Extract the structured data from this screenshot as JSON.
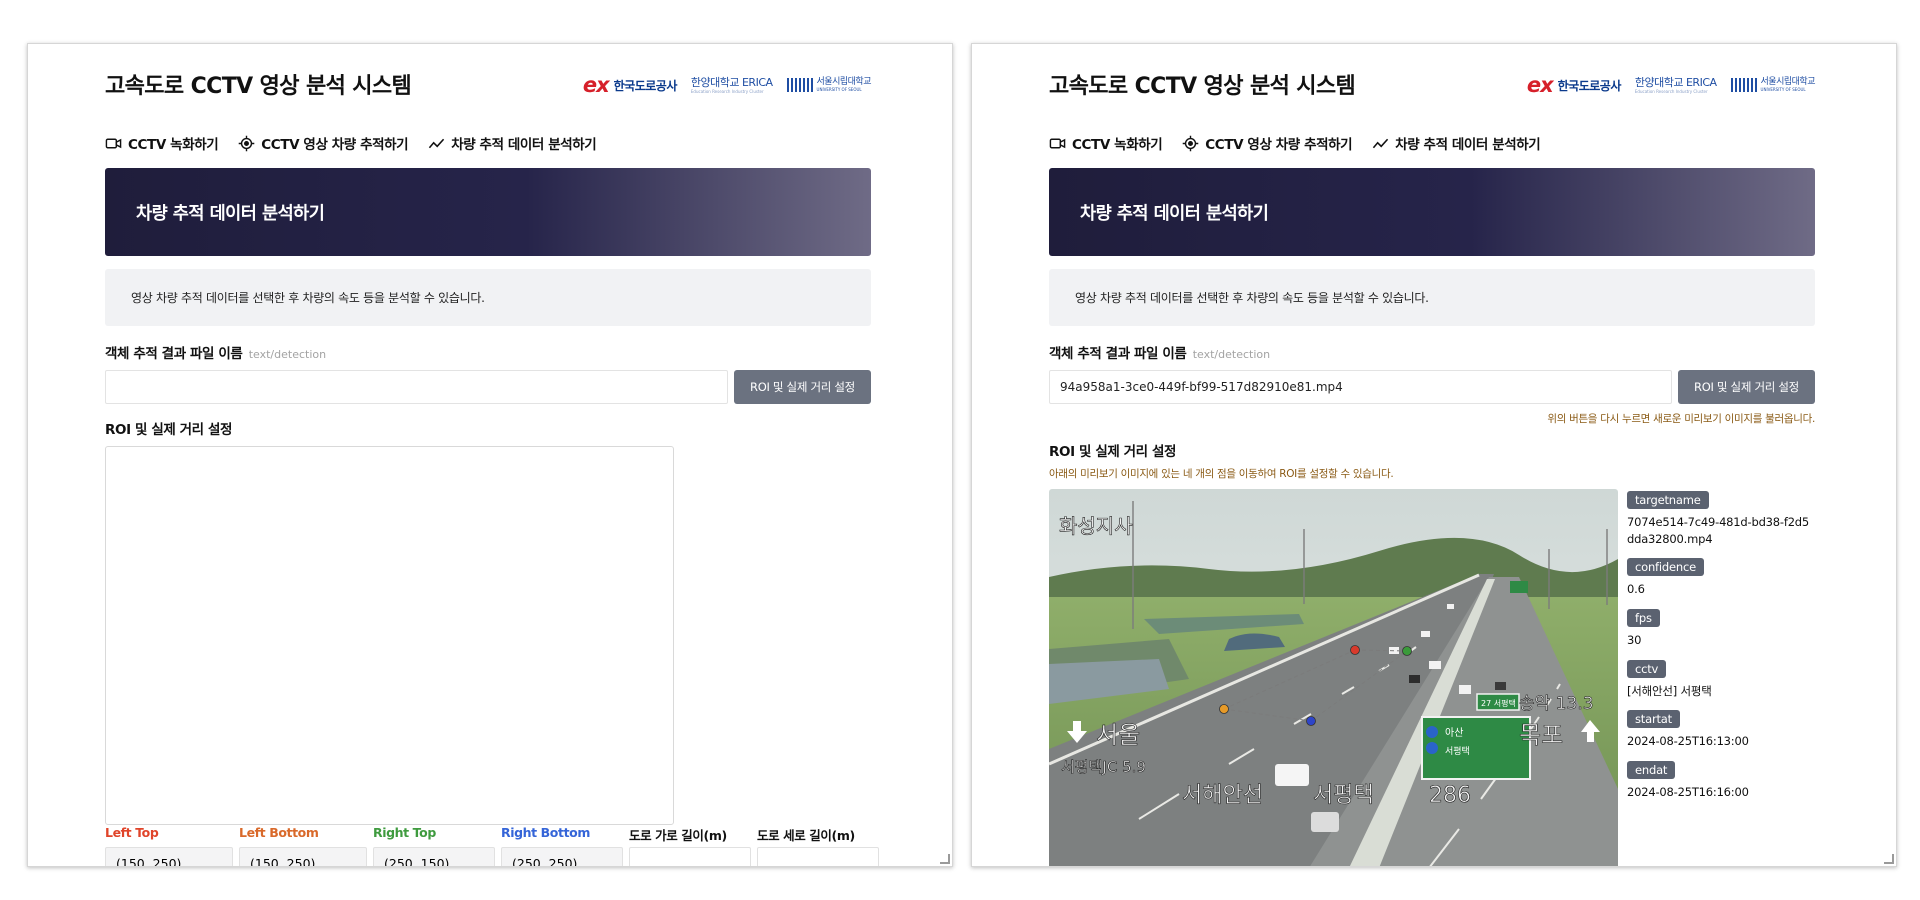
{
  "app": {
    "title": "고속도로 CCTV 영상 분석 시스템",
    "logos": {
      "ex_mark": "ex",
      "ex_text": "한국도로공사",
      "hanyang": "한양대학교 ERICA",
      "hanyang_sub": "Education Research Industry Cluster",
      "seoul": "서울시립대학교",
      "seoul_sub": "UNIVERSITY OF SEOUL"
    }
  },
  "nav": [
    {
      "label": "CCTV 녹화하기",
      "icon": "video-camera-icon"
    },
    {
      "label": "CCTV 영상 차량 추적하기",
      "icon": "target-icon"
    },
    {
      "label": "차량 추적 데이터 분석하기",
      "icon": "trend-line-icon"
    }
  ],
  "banner": {
    "title": "차량 추적 데이터 분석하기"
  },
  "info": "영상 차량 추적 데이터를 선택한 후 차량의 속도 등을 분석할 수 있습니다.",
  "file_section": {
    "label": "객체 추적 결과 파일 이름",
    "hint": "text/detection",
    "button": "ROI 및 실제 거리 설정"
  },
  "roi_section": {
    "label": "ROI 및 실제 거리 설정"
  },
  "left": {
    "file_value": "",
    "coords": {
      "left_top": {
        "label": "Left Top",
        "value": "(150, 250)"
      },
      "left_bottom": {
        "label": "Left Bottom",
        "value": "(150, 250)"
      },
      "right_top": {
        "label": "Right Top",
        "value": "(250, 150)"
      },
      "right_bottom": {
        "label": "Right Bottom",
        "value": "(250, 250)"
      },
      "road_width": {
        "label": "도로 가로 길이(m)",
        "value": ""
      },
      "road_length": {
        "label": "도로 세로 길이(m)",
        "value": ""
      }
    }
  },
  "right": {
    "file_value": "94a958a1-3ce0-449f-bf99-517d82910e81.mp4",
    "reload_note": "위의 버튼을 다시 누르면 새로운 미리보기 이미지를 불러옵니다.",
    "roi_note": "아래의 미리보기 이미지에 있는 네 개의 점을 이동하여 ROI를 설정할 수 있습니다.",
    "overlay": {
      "station": "화성지사",
      "seoul": "서울",
      "mokpo": "목포",
      "jc": "서평택JC 5.9",
      "road_name": "서해안선",
      "town": "서평택",
      "km": "286",
      "right_sign": "송악 13.3",
      "sign_top": "27 서평택",
      "sign_asan": "아산",
      "sign_seopyeongtaek": "서평택"
    },
    "meta": [
      {
        "key": "targetname",
        "value": "7074e514-7c49-481d-bd38-f2d5dda32800.mp4"
      },
      {
        "key": "confidence",
        "value": "0.6"
      },
      {
        "key": "fps",
        "value": "30"
      },
      {
        "key": "cctv",
        "value": "[서해안선] 서평택"
      },
      {
        "key": "startat",
        "value": "2024-08-25T16:13:00"
      },
      {
        "key": "endat",
        "value": "2024-08-25T16:16:00"
      }
    ]
  },
  "colors": {
    "left_top": "#e0442a",
    "left_bottom": "#d9692a",
    "right_top": "#3f9b3f",
    "right_bottom": "#3565d8",
    "banner_dark": "#1f1d3b",
    "button": "#6b7280",
    "note": "#8a5a14"
  }
}
